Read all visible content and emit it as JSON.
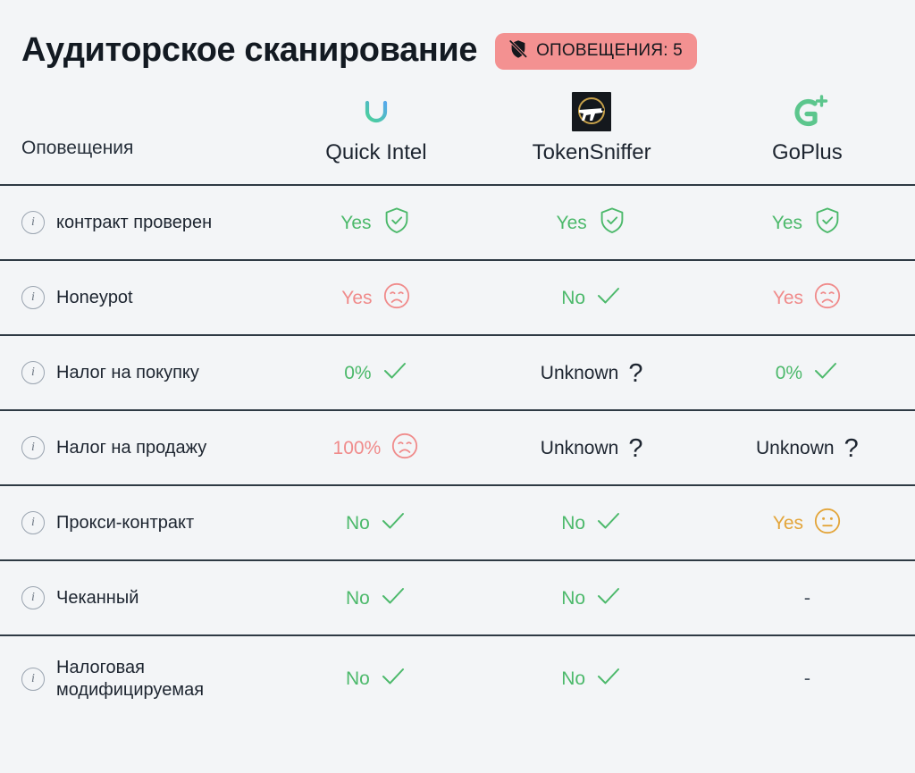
{
  "header": {
    "title": "Аудиторское сканирование",
    "badge": {
      "icon": "shield-off-icon",
      "label": "ОПОВЕЩЕНИЯ: 5",
      "count": 5,
      "bg_color": "#f39191",
      "text_color": "#14181d"
    }
  },
  "table": {
    "label_column_header": "Оповещения",
    "providers": [
      {
        "name": "Quick Intel",
        "logo": "quick-intel-logo"
      },
      {
        "name": "TokenSniffer",
        "logo": "tokensniffer-logo"
      },
      {
        "name": "GoPlus",
        "logo": "goplus-logo"
      }
    ],
    "rows": [
      {
        "label": "контракт проверен",
        "info_icon": "info-icon",
        "cells": [
          {
            "text": "Yes",
            "tone": "green",
            "icon": "shield-check-icon"
          },
          {
            "text": "Yes",
            "tone": "green",
            "icon": "shield-check-icon"
          },
          {
            "text": "Yes",
            "tone": "green",
            "icon": "shield-check-icon"
          }
        ]
      },
      {
        "label": "Honeypot",
        "info_icon": "info-icon",
        "cells": [
          {
            "text": "Yes",
            "tone": "red",
            "icon": "sad-face-icon"
          },
          {
            "text": "No",
            "tone": "green",
            "icon": "check-icon"
          },
          {
            "text": "Yes",
            "tone": "red",
            "icon": "sad-face-icon"
          }
        ]
      },
      {
        "label": "Налог на покупку",
        "info_icon": "info-icon",
        "cells": [
          {
            "text": "0%",
            "tone": "green",
            "icon": "check-icon"
          },
          {
            "text": "Unknown",
            "tone": "dark",
            "icon": "question-mark-icon"
          },
          {
            "text": "0%",
            "tone": "green",
            "icon": "check-icon"
          }
        ]
      },
      {
        "label": "Налог на продажу",
        "info_icon": "info-icon",
        "cells": [
          {
            "text": "100%",
            "tone": "red",
            "icon": "sad-face-icon"
          },
          {
            "text": "Unknown",
            "tone": "dark",
            "icon": "question-mark-icon"
          },
          {
            "text": "Unknown",
            "tone": "dark",
            "icon": "question-mark-icon"
          }
        ]
      },
      {
        "label": "Прокси-контракт",
        "info_icon": "info-icon",
        "cells": [
          {
            "text": "No",
            "tone": "green",
            "icon": "check-icon"
          },
          {
            "text": "No",
            "tone": "green",
            "icon": "check-icon"
          },
          {
            "text": "Yes",
            "tone": "amber",
            "icon": "neutral-face-icon"
          }
        ]
      },
      {
        "label": "Чеканный",
        "info_icon": "info-icon",
        "cells": [
          {
            "text": "No",
            "tone": "green",
            "icon": "check-icon"
          },
          {
            "text": "No",
            "tone": "green",
            "icon": "check-icon"
          },
          {
            "text": "-",
            "tone": "dash",
            "icon": "none"
          }
        ]
      },
      {
        "label": "Налоговая модифицируемая",
        "info_icon": "info-icon",
        "cells": [
          {
            "text": "No",
            "tone": "green",
            "icon": "check-icon"
          },
          {
            "text": "No",
            "tone": "green",
            "icon": "check-icon"
          },
          {
            "text": "-",
            "tone": "dash",
            "icon": "none"
          }
        ]
      }
    ]
  },
  "colors": {
    "background": "#f3f5f7",
    "separator": "#2e3a44",
    "green": "#4cb96b",
    "red": "#f08b8b",
    "amber": "#e3a53a",
    "dark": "#1d2530"
  }
}
